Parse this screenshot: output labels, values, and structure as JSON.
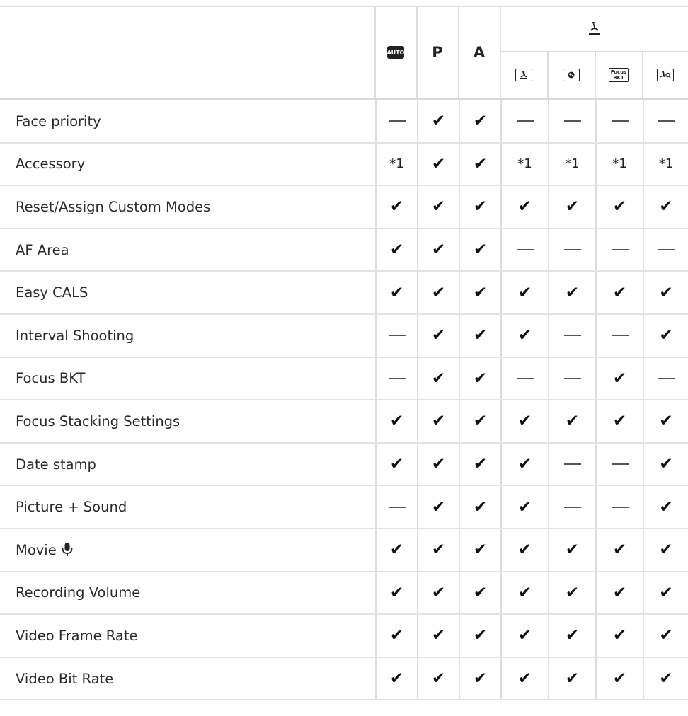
{
  "header": {
    "auto_icon_text": "AUTO",
    "p_label": "P",
    "a_label": "A",
    "micro_group_icon": "microscope-icon",
    "sub_icons": {
      "microscope_frame": "microscope-frame-icon",
      "microscope_depth": "microscope-depth-icon",
      "focus_bkt_line1": "Focus",
      "focus_bkt_line2": "BKT",
      "microscope_magnify": "microscope-magnify-icon"
    }
  },
  "rows": [
    {
      "label": "Face priority",
      "values": [
        "—",
        "✔",
        "✔",
        "—",
        "—",
        "—",
        "—"
      ]
    },
    {
      "label": "Accessory",
      "values": [
        "*1",
        "✔",
        "✔",
        "*1",
        "*1",
        "*1",
        "*1"
      ]
    },
    {
      "label": "Reset/Assign Custom Modes",
      "values": [
        "✔",
        "✔",
        "✔",
        "✔",
        "✔",
        "✔",
        "✔"
      ]
    },
    {
      "label": "AF Area",
      "values": [
        "✔",
        "✔",
        "✔",
        "—",
        "—",
        "—",
        "—"
      ]
    },
    {
      "label": "Easy CALS",
      "values": [
        "✔",
        "✔",
        "✔",
        "✔",
        "✔",
        "✔",
        "✔"
      ]
    },
    {
      "label": "Interval Shooting",
      "values": [
        "—",
        "✔",
        "✔",
        "✔",
        "—",
        "—",
        "✔"
      ]
    },
    {
      "label": "Focus BKT",
      "values": [
        "—",
        "✔",
        "✔",
        "—",
        "—",
        "✔",
        "—"
      ]
    },
    {
      "label": "Focus Stacking Settings",
      "values": [
        "✔",
        "✔",
        "✔",
        "✔",
        "✔",
        "✔",
        "✔"
      ]
    },
    {
      "label": "Date stamp",
      "values": [
        "✔",
        "✔",
        "✔",
        "✔",
        "—",
        "—",
        "✔"
      ]
    },
    {
      "label": "Picture + Sound",
      "values": [
        "—",
        "✔",
        "✔",
        "✔",
        "—",
        "—",
        "✔"
      ]
    },
    {
      "label": "Movie",
      "label_icon": "microphone-icon",
      "values": [
        "✔",
        "✔",
        "✔",
        "✔",
        "✔",
        "✔",
        "✔"
      ]
    },
    {
      "label": "Recording Volume",
      "values": [
        "✔",
        "✔",
        "✔",
        "✔",
        "✔",
        "✔",
        "✔"
      ]
    },
    {
      "label": "Video Frame Rate",
      "values": [
        "✔",
        "✔",
        "✔",
        "✔",
        "✔",
        "✔",
        "✔"
      ]
    },
    {
      "label": "Video Bit Rate",
      "values": [
        "✔",
        "✔",
        "✔",
        "✔",
        "✔",
        "✔",
        "✔"
      ]
    }
  ]
}
